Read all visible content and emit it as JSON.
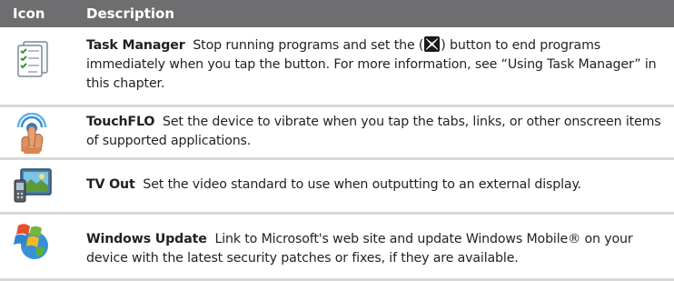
{
  "header": {
    "icon_label": "Icon",
    "description_label": "Description"
  },
  "rows": [
    {
      "icon": "task-manager-icon",
      "title": "Task Manager",
      "text_before": "Stop running programs and set the (",
      "button_icon": "close-x-icon",
      "text_after": ") button to end programs immediately when you tap the button. For more information, see “Using Task Manager” in this chapter."
    },
    {
      "icon": "touchflo-icon",
      "title": "TouchFLO",
      "text": "Set the device to vibrate when you tap the tabs, links, or other onscreen items of supported applications."
    },
    {
      "icon": "tv-out-icon",
      "title": "TV Out",
      "text": "Set the video standard to use when outputting to an external display."
    },
    {
      "icon": "windows-update-icon",
      "title": "Windows Update",
      "text": "Link to Microsoft's web site and update Windows Mobile® on your device with the latest security patches or fixes, if they are available."
    }
  ]
}
